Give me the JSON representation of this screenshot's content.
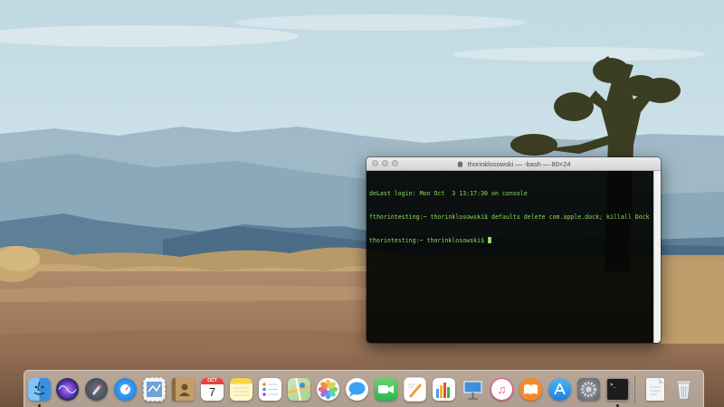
{
  "desktop": {
    "wallpaper": "desert-road-joshua-tree"
  },
  "terminal": {
    "title": "thorinklosowski — -bash — 80×24",
    "lines": [
      "deLast login: Mon Oct  3 13:17:30 on console",
      "fthorintesting:~ thorinklosowski$ defaults delete com.apple.dock; killall Dock  ]",
      "thorintesting:~ thorinklosowski$ "
    ],
    "text_color": "#8bdb5a"
  },
  "dock": {
    "calendar_month": "OCT",
    "calendar_day": "7",
    "items": [
      {
        "name": "Finder",
        "icon": "finder-icon",
        "running": true
      },
      {
        "name": "Siri",
        "icon": "siri-icon",
        "running": false
      },
      {
        "name": "Launchpad",
        "icon": "launchpad-icon",
        "running": false
      },
      {
        "name": "Safari",
        "icon": "safari-icon",
        "running": false
      },
      {
        "name": "Mail",
        "icon": "mail-icon",
        "running": false
      },
      {
        "name": "Contacts",
        "icon": "contacts-icon",
        "running": false
      },
      {
        "name": "Calendar",
        "icon": "calendar-icon",
        "running": false
      },
      {
        "name": "Notes",
        "icon": "notes-icon",
        "running": false
      },
      {
        "name": "Reminders",
        "icon": "reminders-icon",
        "running": false
      },
      {
        "name": "Maps",
        "icon": "maps-icon",
        "running": false
      },
      {
        "name": "Photos",
        "icon": "photos-icon",
        "running": false
      },
      {
        "name": "Messages",
        "icon": "messages-icon",
        "running": false
      },
      {
        "name": "FaceTime",
        "icon": "facetime-icon",
        "running": false
      },
      {
        "name": "Pages",
        "icon": "pages-icon",
        "running": false
      },
      {
        "name": "Numbers",
        "icon": "numbers-icon",
        "running": false
      },
      {
        "name": "Keynote",
        "icon": "keynote-icon",
        "running": false
      },
      {
        "name": "iTunes",
        "icon": "itunes-icon",
        "running": false
      },
      {
        "name": "iBooks",
        "icon": "ibooks-icon",
        "running": false
      },
      {
        "name": "App Store",
        "icon": "app-store-icon",
        "running": false
      },
      {
        "name": "System Preferences",
        "icon": "system-preferences-icon",
        "running": false
      },
      {
        "name": "Terminal",
        "icon": "terminal-icon",
        "running": true
      },
      {
        "name": "Documents",
        "icon": "documents-icon",
        "running": false
      },
      {
        "name": "Trash",
        "icon": "trash-icon",
        "running": false
      }
    ]
  }
}
